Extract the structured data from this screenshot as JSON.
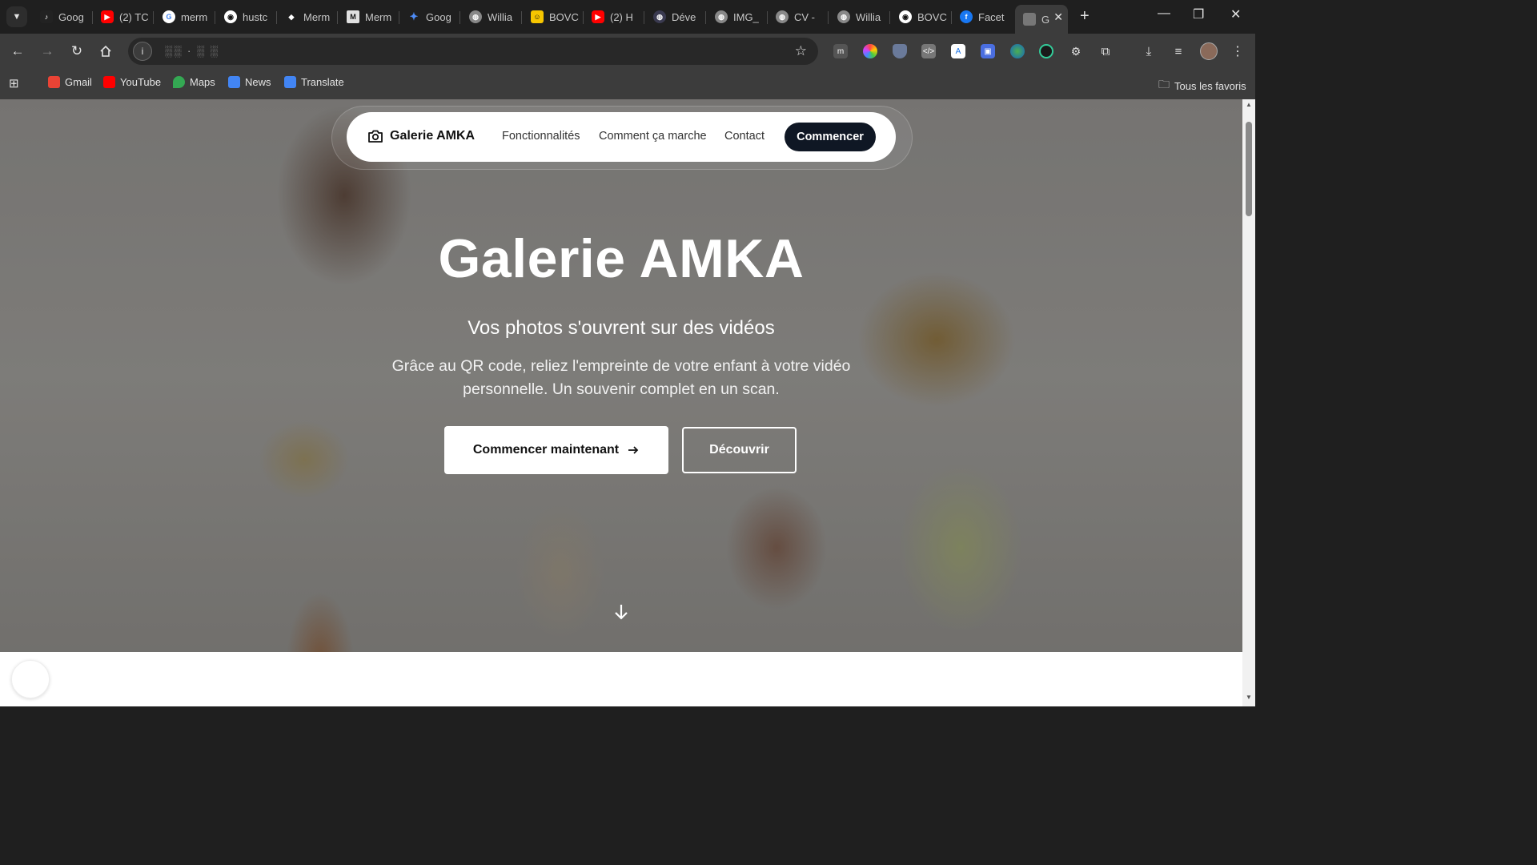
{
  "browser": {
    "tabs": [
      {
        "label": "Goog",
        "icon": "tiktok-icon",
        "color": "#222222"
      },
      {
        "label": "(2) TC",
        "icon": "youtube-icon",
        "color": "#ff0000"
      },
      {
        "label": "merm",
        "icon": "google-icon",
        "color": "#4285f4"
      },
      {
        "label": "hustc",
        "icon": "github-icon",
        "color": "#333333"
      },
      {
        "label": "Merm",
        "icon": "mermaid-icon",
        "color": "#ff3670"
      },
      {
        "label": "Merm",
        "icon": "m-icon",
        "color": "#e0e0e0"
      },
      {
        "label": "Goog",
        "icon": "gemini-icon",
        "color": "#4e8cf7"
      },
      {
        "label": "Willia",
        "icon": "globe-icon",
        "color": "#888888"
      },
      {
        "label": "BOVC",
        "icon": "yellow-icon",
        "color": "#f7c600"
      },
      {
        "label": "(2) H",
        "icon": "youtube-icon",
        "color": "#ff0000"
      },
      {
        "label": "Déve",
        "icon": "globe-icon",
        "color": "#3a3a50"
      },
      {
        "label": "IMG_",
        "icon": "globe-icon",
        "color": "#888888"
      },
      {
        "label": "CV -",
        "icon": "globe-icon",
        "color": "#888888"
      },
      {
        "label": "Willia",
        "icon": "globe-icon",
        "color": "#888888"
      },
      {
        "label": "BOVC",
        "icon": "github-icon",
        "color": "#333333"
      },
      {
        "label": "Facet",
        "icon": "facebook-icon",
        "color": "#1877f2"
      }
    ],
    "active_tab": {
      "label": "G",
      "close": "✕"
    },
    "new_tab": "+",
    "window": {
      "minimize": "—",
      "restore": "❐",
      "close": "✕"
    },
    "address": {
      "info": "i",
      "url": "░░ · ░ ░"
    },
    "bookmarks": [
      {
        "label": "Gmail",
        "color": "#ea4335"
      },
      {
        "label": "YouTube",
        "color": "#ff0000"
      },
      {
        "label": "Maps",
        "color": "#34a853"
      },
      {
        "label": "News",
        "color": "#4285f4"
      },
      {
        "label": "Translate",
        "color": "#4285f4"
      }
    ],
    "all_bookmarks": "Tous les favoris"
  },
  "site": {
    "brand": "Galerie AMKA",
    "nav": [
      "Fonctionnalités",
      "Comment ça marche",
      "Contact"
    ],
    "nav_cta": "Commencer",
    "hero": {
      "title": "Galerie AMKA",
      "subtitle": "Vos photos s'ouvrent sur des vidéos",
      "description": "Grâce au QR code, reliez l'empreinte de votre enfant à votre vidéo personnelle. Un souvenir complet en un scan.",
      "primary_button": "Commencer maintenant",
      "secondary_button": "Découvrir"
    }
  }
}
